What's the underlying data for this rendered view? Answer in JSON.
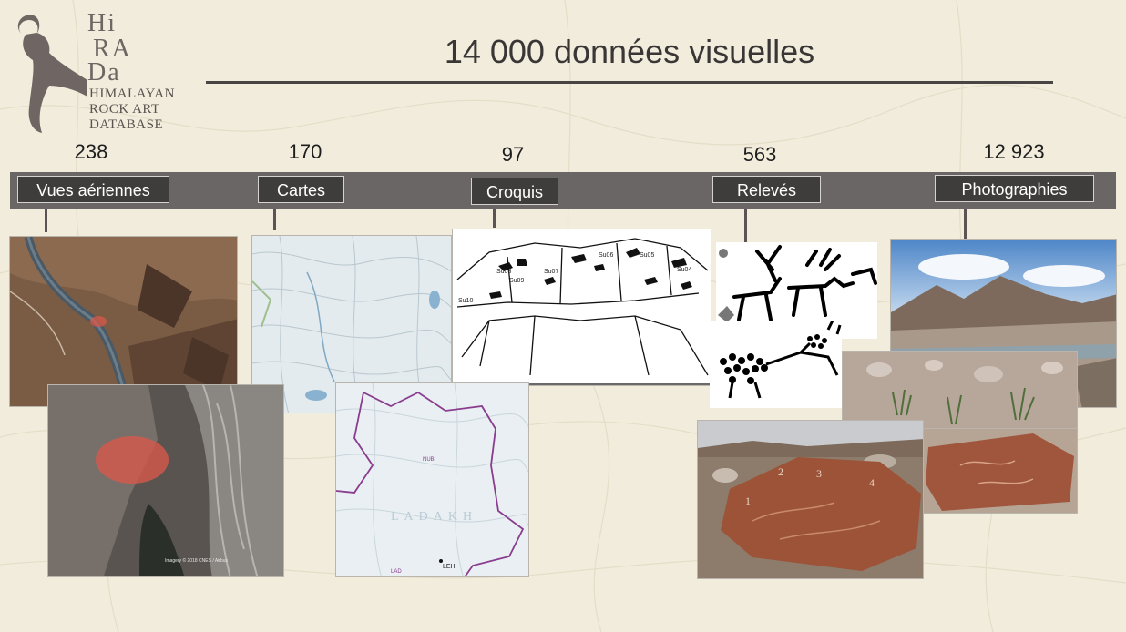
{
  "slide": {
    "title": "14 000 données visuelles"
  },
  "logo": {
    "letters": [
      "Hi",
      "RA",
      "Da"
    ],
    "lines": [
      "HIMALAYAN",
      "ROCK ART",
      "DATABASE"
    ]
  },
  "categories": [
    {
      "count": "238",
      "label": "Vues aériennes"
    },
    {
      "count": "170",
      "label": "Cartes"
    },
    {
      "count": "97",
      "label": "Croquis"
    },
    {
      "count": "563",
      "label": "Relevés"
    },
    {
      "count": "12 923",
      "label": "Photographies"
    }
  ],
  "images": {
    "map_labels": [
      "NUB",
      "LADAKH",
      "LAD",
      "LEH"
    ],
    "sketch_labels": [
      "Su08",
      "Su09",
      "Su07",
      "Su06",
      "Su05",
      "Su04",
      "Su10"
    ],
    "rock_numbers": [
      "1",
      "2",
      "3",
      "4"
    ],
    "satellite_credit": "Imagery © 2018 CNES / Airbus"
  },
  "colors": {
    "background": "#f1ecdc",
    "band": "#6a6666",
    "button": "#3f3c3c",
    "highlight": "#d9584a"
  }
}
